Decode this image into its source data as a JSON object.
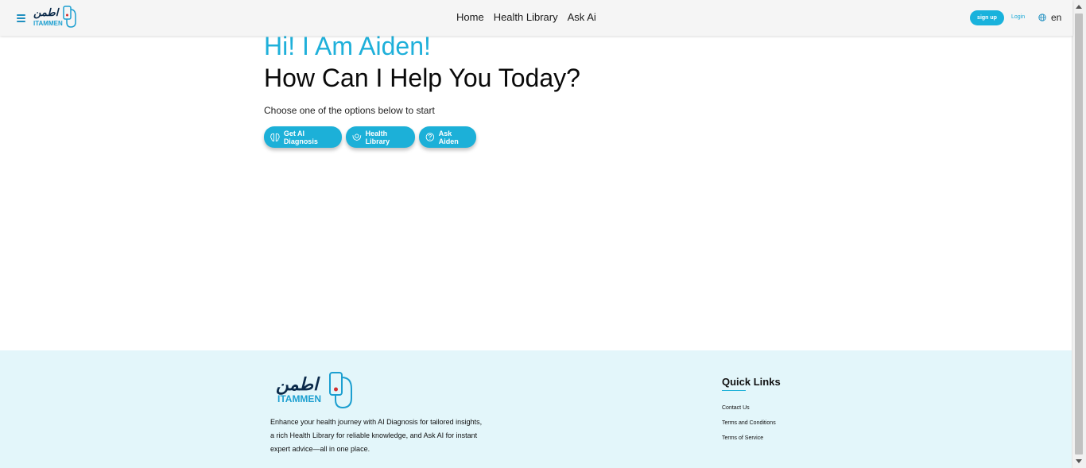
{
  "header": {
    "logo_ar": "اطمن",
    "logo_en": "ITAMMEN",
    "nav": [
      "Home",
      "Health Library",
      "Ask Ai"
    ],
    "signup_label": "sign up",
    "login_label": "Login",
    "lang": "en"
  },
  "hero": {
    "greeting": "Hi! I Am Aiden!",
    "title": "How Can I Help You Today?",
    "subtitle": "Choose one of the options below to start",
    "options": [
      {
        "label": "Get AI Diagnosis",
        "icon": "brain-icon"
      },
      {
        "label": "Health Library",
        "icon": "library-icon"
      },
      {
        "label": "Ask Aiden",
        "icon": "question-icon"
      }
    ]
  },
  "footer": {
    "logo_ar": "اطمن",
    "logo_en": "ITAMMEN",
    "description_lines": [
      "Enhance your health journey with AI Diagnosis for tailored insights,",
      "a rich Health Library for reliable knowledge, and Ask AI for instant",
      "expert advice—all in one place."
    ],
    "quick_links_title": "Quick Links",
    "quick_links": [
      "Contact Us",
      "Terms and Conditions",
      "Terms of Service"
    ]
  },
  "colors": {
    "accent": "#1cb0d8",
    "footer_bg": "#e3f6fa",
    "header_bg": "#f5f5f5"
  }
}
